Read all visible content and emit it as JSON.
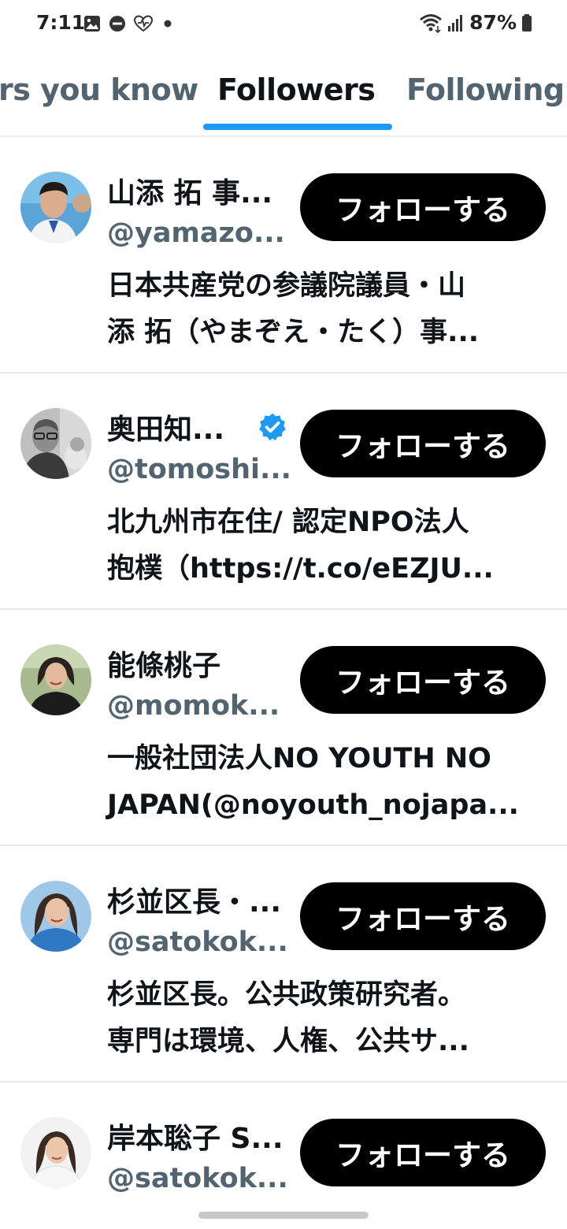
{
  "status_bar": {
    "time": "7:11",
    "battery_text": "87%",
    "icons": [
      "image-icon",
      "dnd-icon",
      "heart-monitor-icon",
      "dot-icon",
      "wifi-icon",
      "signal-icon",
      "battery-icon"
    ]
  },
  "tabs": {
    "items": [
      {
        "label": "rs you know",
        "state": "inactive"
      },
      {
        "label": "Followers",
        "state": "active"
      },
      {
        "label": "Following",
        "state": "inactive"
      }
    ],
    "accent_color": "#1d9bf0"
  },
  "users": [
    {
      "name": "山添 拓 事...",
      "handle": "@yamazo...",
      "verified": false,
      "follow_label": "フォローする",
      "bio_lines": [
        "日本共産党の参議院議員・山",
        "添 拓（やまぞえ・たく）事..."
      ]
    },
    {
      "name": "奥田知...",
      "handle": "@tomoshi...",
      "verified": true,
      "follow_label": "フォローする",
      "bio_lines": [
        "北九州市在住/ 認定NPO法人",
        "抱樸（https://t.co/eEZJU..."
      ]
    },
    {
      "name": "能條桃子",
      "handle": "@momok...",
      "verified": false,
      "follow_label": "フォローする",
      "bio_lines": [
        "一般社団法人NO YOUTH NO",
        "JAPAN(@noyouth_nojapa..."
      ]
    },
    {
      "name": "杉並区長・...",
      "handle": "@satokok...",
      "verified": false,
      "follow_label": "フォローする",
      "bio_lines": [
        "杉並区長。公共政策研究者。",
        "専門は環境、人権、公共サ..."
      ]
    },
    {
      "name": "岸本聡子 S...",
      "handle": "@satokok...",
      "verified": false,
      "follow_label": "フォローする",
      "bio_lines": []
    }
  ],
  "colors": {
    "text": "#0f1419",
    "secondary": "#536471",
    "button_bg": "#000000",
    "verified": "#1d9bf0"
  }
}
